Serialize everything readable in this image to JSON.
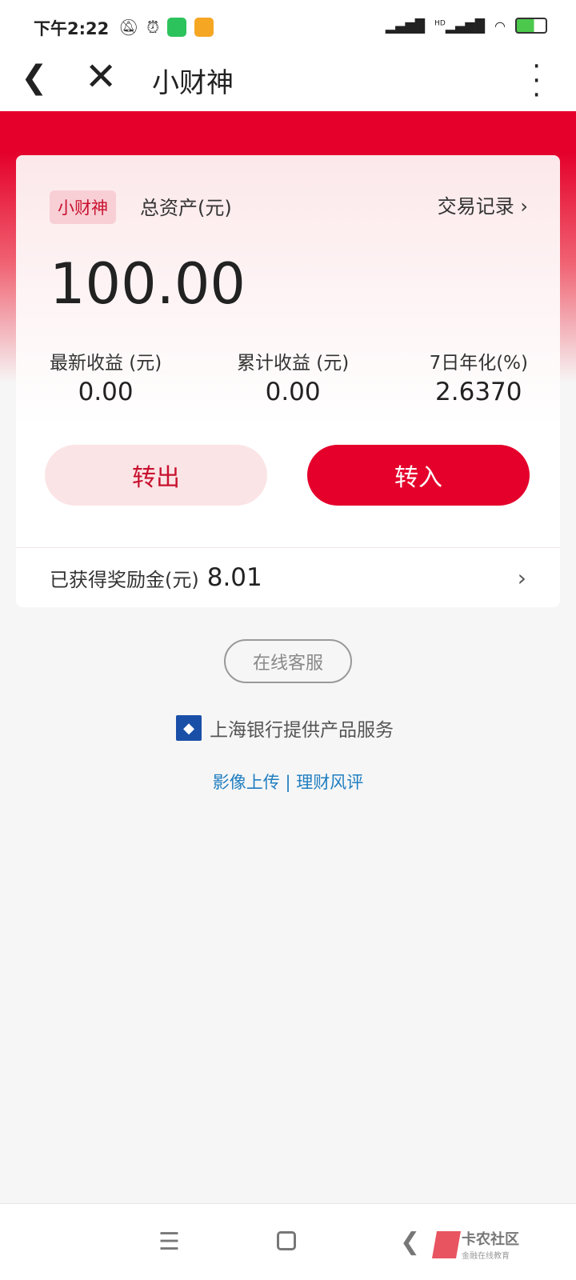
{
  "status_bar": {
    "time": "下午2:22",
    "network": "HD",
    "icons": [
      "mute-bell-icon",
      "alarm-icon",
      "wechat-icon",
      "notes-app-icon",
      "signal-icon",
      "wifi-icon",
      "battery-charging-icon"
    ]
  },
  "nav": {
    "title": "小财神",
    "back": "back-icon",
    "close": "close-icon",
    "more": "more-icon"
  },
  "card": {
    "tag": "小财神",
    "total_label": "总资产(元)",
    "records_label": "交易记录",
    "amount": "100.00",
    "stats": [
      {
        "label": "最新收益 (元)",
        "value": "0.00"
      },
      {
        "label": "累计收益 (元)",
        "value": "0.00"
      },
      {
        "label": "7日年化(%)",
        "value": "2.6370"
      }
    ],
    "transfer_out": "转出",
    "transfer_in": "转入",
    "reward_label": "已获得奖励金(元)",
    "reward_value": "8.01"
  },
  "service_button": "在线客服",
  "provider": "上海银行提供产品服务",
  "links": {
    "upload": "影像上传",
    "separator": "|",
    "risk": "理财风评"
  },
  "watermark": {
    "name": "卡农社区",
    "slogan": "金融在线教育"
  },
  "colors": {
    "brand": "#e4002b",
    "link": "#1f7ec0"
  }
}
